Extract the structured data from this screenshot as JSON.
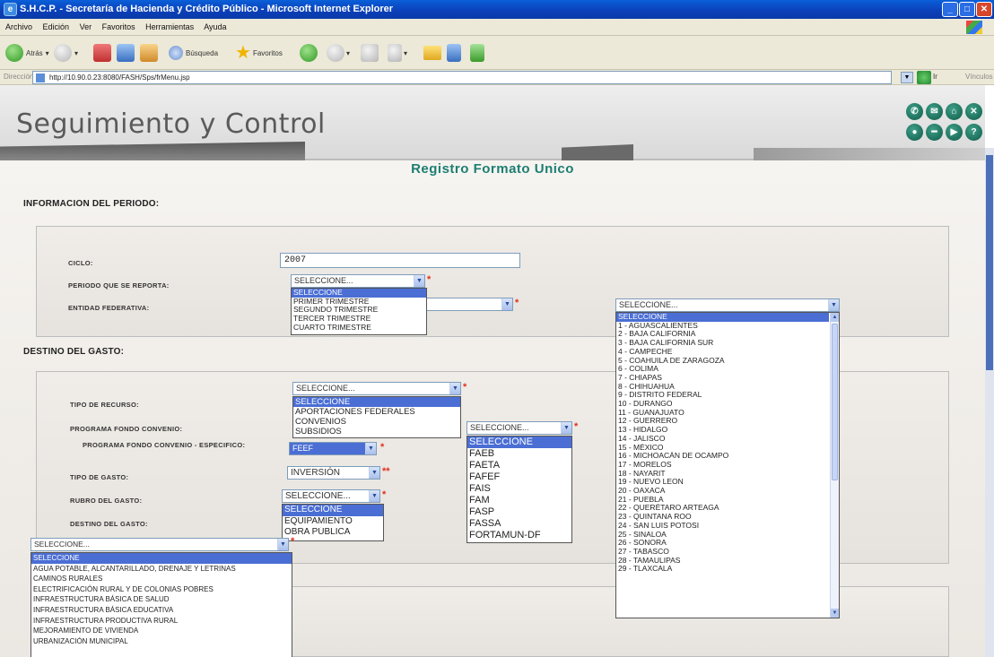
{
  "window": {
    "title": "S.H.C.P. - Secretaría de Hacienda y Crédito Público - Microsoft Internet Explorer",
    "min": "_",
    "max": "□",
    "close": "✕"
  },
  "menu": [
    "Archivo",
    "Edición",
    "Ver",
    "Favoritos",
    "Herramientas",
    "Ayuda"
  ],
  "toolbar": {
    "back": "Atrás",
    "search": "Búsqueda",
    "favorites": "Favoritos"
  },
  "address": {
    "label": "Dirección",
    "url": "http://10.90.0.23:8080/FASH/Sps/frMenu.jsp",
    "go": "Ir",
    "links": "Vínculos"
  },
  "header": {
    "title": "Seguimiento y Control"
  },
  "page_title": "Registro Formato Unico",
  "sections": {
    "periodo": "INFORMACION DEL PERIODO:",
    "destino": "DESTINO DEL GASTO:"
  },
  "form": {
    "ciclo_label": "CICLO:",
    "ciclo_value": "2007",
    "periodo_label": "PERIODO QUE SE REPORTA:",
    "entidad_label": "ENTIDAD FEDERATIVA:",
    "tipo_recurso_label": "TIPO DE RECURSO:",
    "programa_label": "PROGRAMA FONDO CONVENIO:",
    "programa_esp_label": "PROGRAMA FONDO CONVENIO - ESPECIFICO:",
    "tipo_gasto_label": "TIPO DE GASTO:",
    "rubro_label": "RUBRO DEL GASTO:",
    "destino_label": "DESTINO DEL GASTO:"
  },
  "selects": {
    "periodo": "SELECCIONE...",
    "tipo_recurso": "SELECCIONE...",
    "programa": "SELECCIONE...",
    "programa_esp": "FEEF",
    "tipo_gasto": "INVERSIÓN",
    "rubro": "SELECCIONE...",
    "destino": "SELECCIONE...",
    "entidad": "SELECCIONE..."
  },
  "lists": {
    "periodo": [
      "SELECCIONE",
      "PRIMER TRIMESTRE",
      "SEGUNDO TRIMESTRE",
      "TERCER TRIMESTRE",
      "CUARTO TRIMESTRE"
    ],
    "tipo_recurso": [
      "SELECCIONE",
      "APORTACIONES FEDERALES",
      "CONVENIOS",
      "SUBSIDIOS"
    ],
    "programa": [
      "SELECCIONE",
      "FAEB",
      "FAETA",
      "FAFEF",
      "FAIS",
      "FAM",
      "FASP",
      "FASSA",
      "FORTAMUN-DF"
    ],
    "rubro": [
      "SELECCIONE",
      "EQUIPAMIENTO",
      "OBRA PÚBLICA"
    ],
    "destino": [
      "SELECCIONE",
      "AGUA POTABLE, ALCANTARILLADO, DRENAJE Y LETRINAS",
      "CAMINOS RURALES",
      "ELECTRIFICACIÓN RURAL Y DE COLONIAS POBRES",
      "INFRAESTRUCTURA BÁSICA DE SALUD",
      "INFRAESTRUCTURA BÁSICA EDUCATIVA",
      "INFRAESTRUCTURA PRODUCTIVA RURAL",
      "MEJORAMIENTO DE VIVIENDA",
      "URBANIZACIÓN MUNICIPAL"
    ],
    "entidad": [
      "SELECCIONE",
      "1 - AGUASCALIENTES",
      "2 - BAJA CALIFORNIA",
      "3 - BAJA CALIFORNIA SUR",
      "4 - CAMPECHE",
      "5 - COAHUILA DE ZARAGOZA",
      "6 - COLIMA",
      "7 - CHIAPAS",
      "8 - CHIHUAHUA",
      "9 - DISTRITO FEDERAL",
      "10 - DURANGO",
      "11 - GUANAJUATO",
      "12 - GUERRERO",
      "13 - HIDALGO",
      "14 - JALISCO",
      "15 - MÉXICO",
      "16 - MICHOACÁN DE OCAMPO",
      "17 - MORELOS",
      "18 - NAYARIT",
      "19 - NUEVO LEON",
      "20 - OAXACA",
      "21 - PUEBLA",
      "22 - QUERÉTARO ARTEAGA",
      "23 - QUINTANA ROO",
      "24 - SAN LUIS POTOSI",
      "25 - SINALOA",
      "26 - SONORA",
      "27 - TABASCO",
      "28 - TAMAULIPAS",
      "29 - TLAXCALA"
    ]
  },
  "header_icons": [
    "phone-icon",
    "mail-icon",
    "home-icon",
    "close-icon",
    "record-icon",
    "minus-icon",
    "play-icon",
    "help-icon"
  ],
  "required_marks": {
    "single": "*",
    "double": "**"
  },
  "colors": {
    "title_bar": "#0b3fb8",
    "page_title": "#1d7e72",
    "selection": "#4a6ed4",
    "required": "#e0301e"
  }
}
